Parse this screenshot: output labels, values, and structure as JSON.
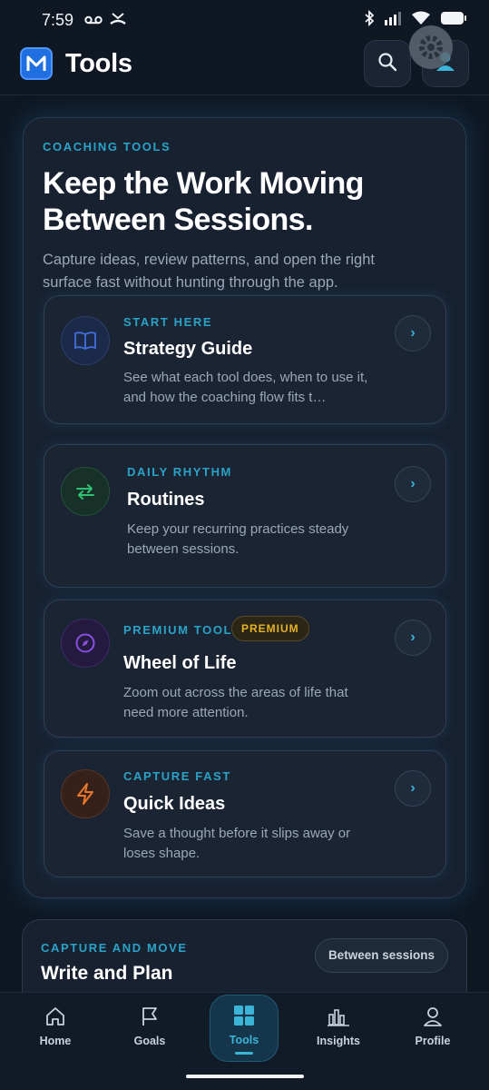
{
  "status": {
    "time": "7:59"
  },
  "app": {
    "title": "Tools"
  },
  "hero": {
    "eyebrow": "COACHING TOOLS",
    "title": "Keep the Work Moving Between Sessions.",
    "subtitle": "Capture ideas, review patterns, and open the right surface fast without hunting through the app."
  },
  "cards": [
    {
      "eyebrow": "START HERE",
      "title": "Strategy Guide",
      "desc": "See what each tool does, when to use it, and how the coaching flow fits t…",
      "icon": "book-icon",
      "accent": "#3f6fd8"
    },
    {
      "eyebrow": "DAILY RHYTHM",
      "title": "Routines",
      "desc": "Keep your recurring practices steady between sessions.",
      "icon": "repeat-icon",
      "accent": "#2fbf71"
    },
    {
      "eyebrow": "PREMIUM TOOL",
      "badge": "PREMIUM",
      "title": "Wheel of Life",
      "desc": "Zoom out across the areas of life that need more attention.",
      "icon": "compass-icon",
      "accent": "#8a4fe0"
    },
    {
      "eyebrow": "CAPTURE FAST",
      "title": "Quick Ideas",
      "desc": "Save a thought before it slips away or loses shape.",
      "icon": "lightning-icon",
      "accent": "#e8762b"
    }
  ],
  "section2": {
    "eyebrow": "CAPTURE AND MOVE",
    "title": "Write and Plan",
    "pill": "Between sessions"
  },
  "nav": [
    {
      "label": "Home",
      "icon": "home-icon"
    },
    {
      "label": "Goals",
      "icon": "flag-icon"
    },
    {
      "label": "Tools",
      "icon": "grid-icon",
      "active": true
    },
    {
      "label": "Insights",
      "icon": "bar-chart-icon"
    },
    {
      "label": "Profile",
      "icon": "person-icon"
    }
  ]
}
